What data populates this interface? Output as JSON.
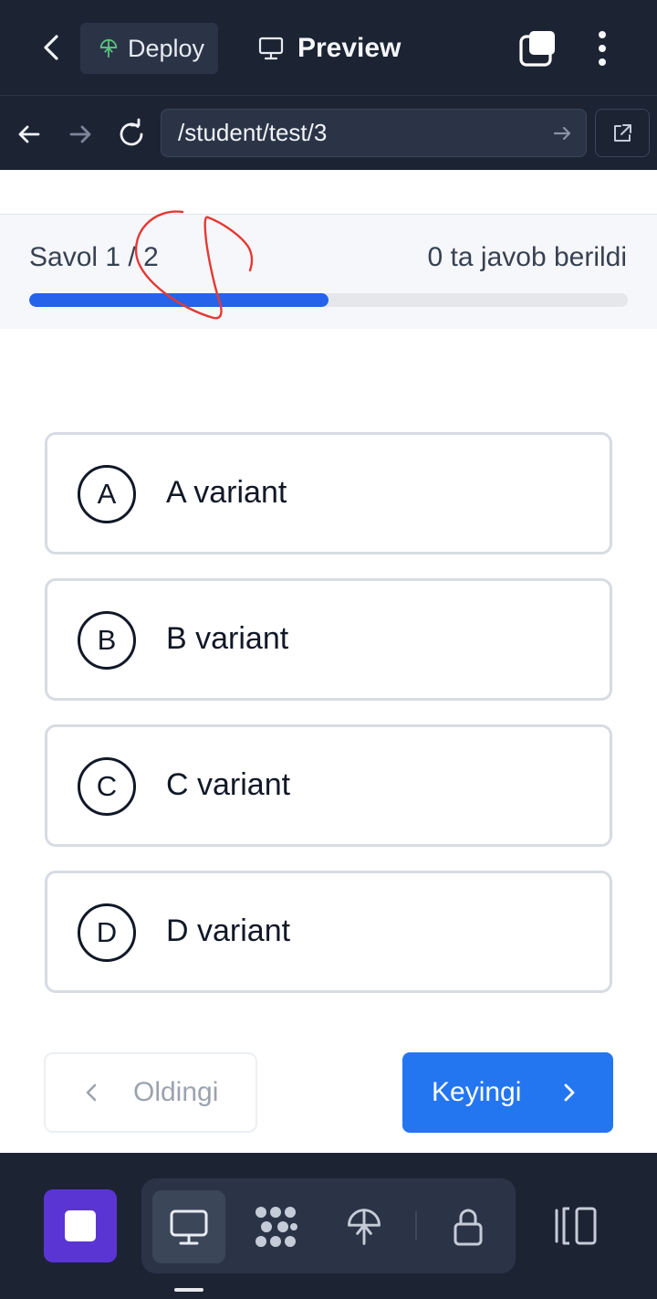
{
  "topbar": {
    "back_icon": "chevron-left-icon",
    "deploy_label": "Deploy",
    "deploy_icon": "deploy-icon",
    "preview_label": "Preview",
    "preview_icon": "monitor-icon",
    "windows_icon": "windows-icon",
    "menu_icon": "kebab-menu-icon"
  },
  "browser": {
    "back_icon": "arrow-left-icon",
    "forward_icon": "arrow-right-icon",
    "reload_icon": "reload-icon",
    "url": "/student/test/3",
    "go_icon": "arrow-right-icon",
    "external_icon": "external-link-icon"
  },
  "quiz": {
    "question_counter": "Savol 1 / 2",
    "answered_text": "0 ta javob berildi",
    "progress_percent": 50,
    "options": [
      {
        "letter": "A",
        "label": "A variant"
      },
      {
        "letter": "B",
        "label": "B variant"
      },
      {
        "letter": "C",
        "label": "C variant"
      },
      {
        "letter": "D",
        "label": "D variant"
      }
    ],
    "prev_label": "Oldingi",
    "next_label": "Keyingi"
  },
  "dock": {
    "stop_icon": "stop-icon",
    "tools": [
      "monitor-icon",
      "workflow-icon",
      "deploy-icon",
      "lock-icon"
    ],
    "active_tool": "monitor-icon",
    "side_icon": "panel-toggle-icon"
  },
  "colors": {
    "chrome_bg": "#1c2333",
    "accent_blue": "#2476f0",
    "progress_fill": "#2563eb",
    "stop_purple": "#5b35d4",
    "annotation_red": "#e53935"
  }
}
